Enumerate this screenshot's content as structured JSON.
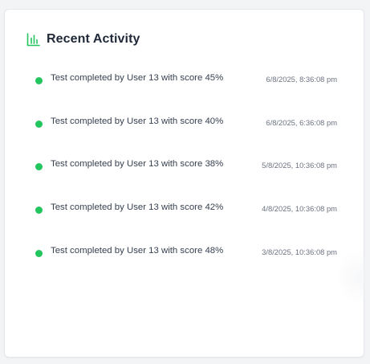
{
  "panel": {
    "title": "Recent Activity",
    "icon": "bar-chart-icon",
    "accent_color": "#22c55e"
  },
  "activities": [
    {
      "text": "Test completed by User 13 with score 45%",
      "time": "6/8/2025, 8:36:08 pm",
      "status_color": "#22c55e"
    },
    {
      "text": "Test completed by User 13 with score 40%",
      "time": "6/8/2025, 6:36:08 pm",
      "status_color": "#22c55e"
    },
    {
      "text": "Test completed by User 13 with score 38%",
      "time": "5/8/2025, 10:36:08 pm",
      "status_color": "#22c55e"
    },
    {
      "text": "Test completed by User 13 with score 42%",
      "time": "4/8/2025, 10:36:08 pm",
      "status_color": "#22c55e"
    },
    {
      "text": "Test completed by User 13 with score 48%",
      "time": "3/8/2025, 10:36:08 pm",
      "status_color": "#22c55e"
    }
  ]
}
